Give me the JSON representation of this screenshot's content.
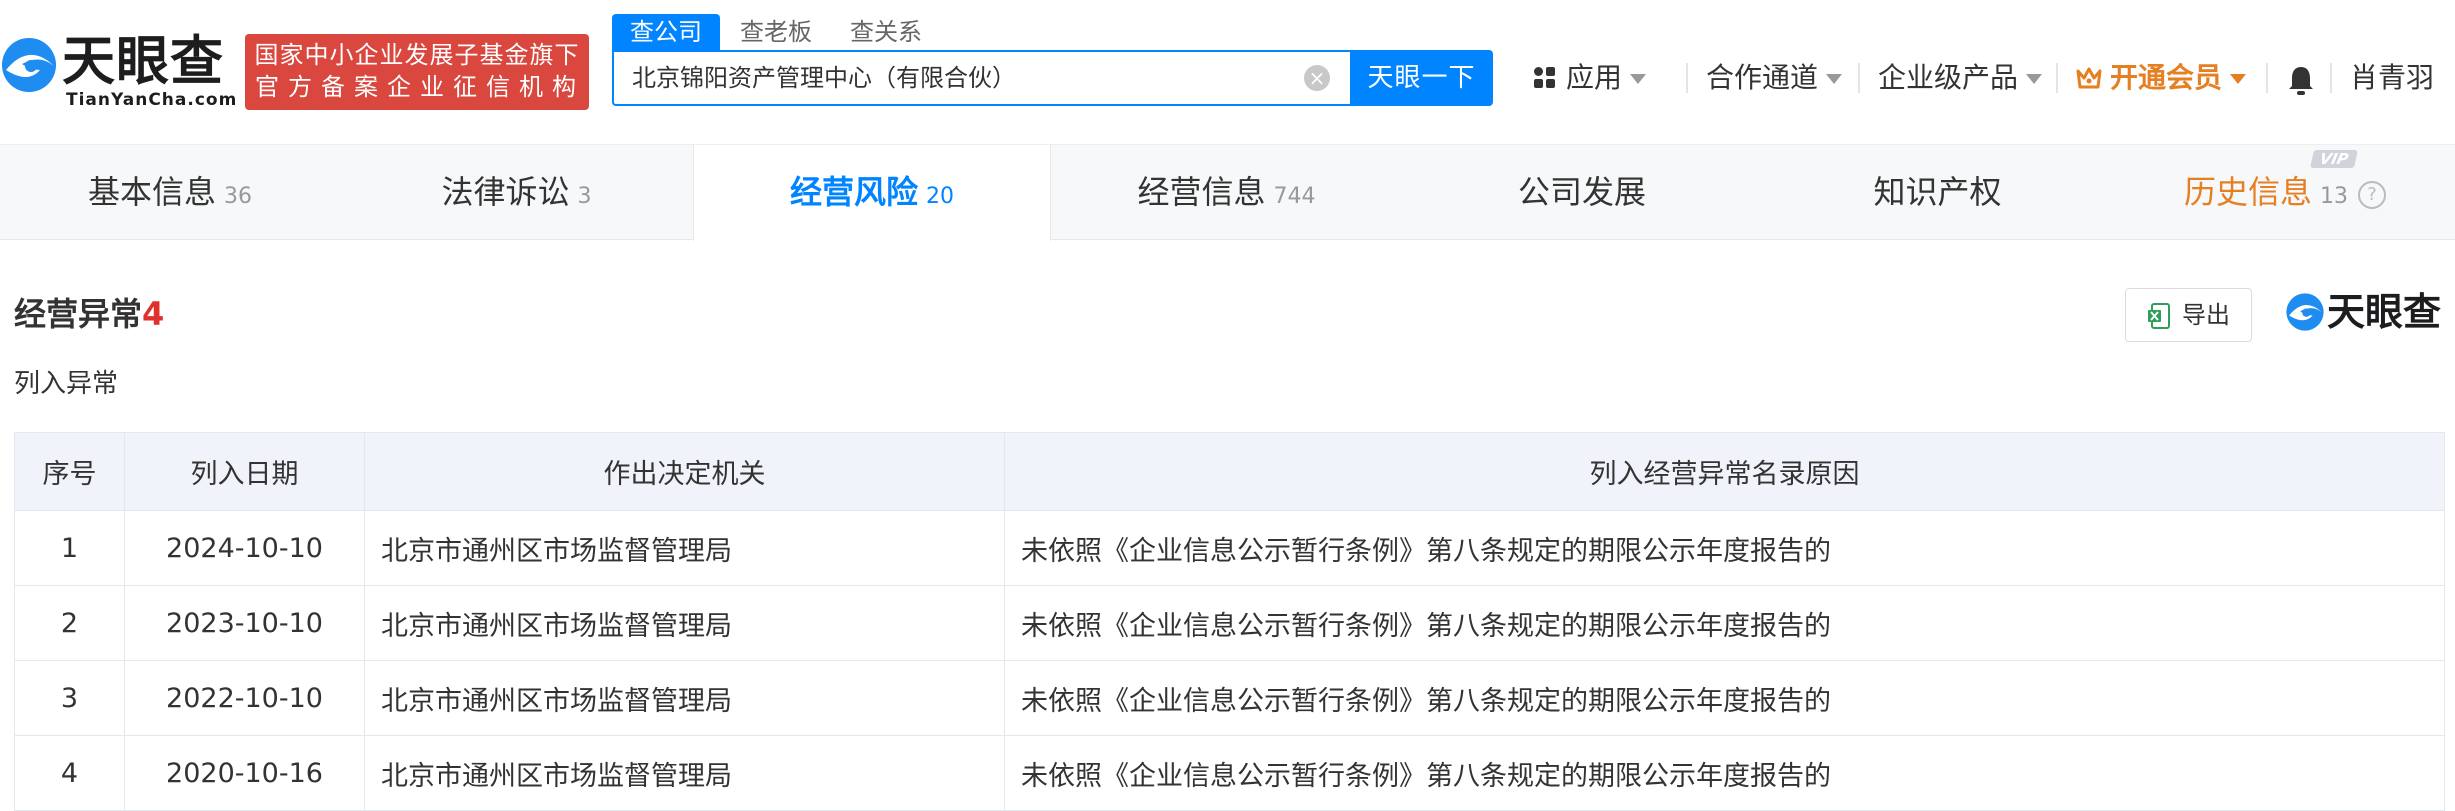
{
  "brand": {
    "name_cn": "天眼查",
    "name_en": "TianYanCha.com",
    "badge_line1": "国家中小企业发展子基金旗下",
    "badge_line2": "官方备案企业征信机构"
  },
  "search": {
    "tabs": [
      "查公司",
      "查老板",
      "查关系"
    ],
    "active_tab": "查公司",
    "value": "北京锦阳资产管理中心（有限合伙）",
    "button_label": "天眼一下"
  },
  "nav": {
    "apps": "应用",
    "partner": "合作通道",
    "enterprise": "企业级产品",
    "vip": "开通会员",
    "user": "肖青羽"
  },
  "tabs": [
    {
      "label": "基本信息",
      "count": "36"
    },
    {
      "label": "法律诉讼",
      "count": "3"
    },
    {
      "label": "经营风险",
      "count": "20"
    },
    {
      "label": "经营信息",
      "count": "744"
    },
    {
      "label": "公司发展",
      "count": ""
    },
    {
      "label": "知识产权",
      "count": ""
    },
    {
      "label": "历史信息",
      "count": "13"
    }
  ],
  "vip_badge": "VIP",
  "section": {
    "title": "经营异常",
    "count": "4",
    "export_label": "导出",
    "subtitle": "列入异常"
  },
  "table": {
    "headers": [
      "序号",
      "列入日期",
      "作出决定机关",
      "列入经营异常名录原因"
    ],
    "rows": [
      {
        "no": "1",
        "date": "2024-10-10",
        "authority": "北京市通州区市场监督管理局",
        "reason": "未依照《企业信息公示暂行条例》第八条规定的期限公示年度报告的"
      },
      {
        "no": "2",
        "date": "2023-10-10",
        "authority": "北京市通州区市场监督管理局",
        "reason": "未依照《企业信息公示暂行条例》第八条规定的期限公示年度报告的"
      },
      {
        "no": "3",
        "date": "2022-10-10",
        "authority": "北京市通州区市场监督管理局",
        "reason": "未依照《企业信息公示暂行条例》第八条规定的期限公示年度报告的"
      },
      {
        "no": "4",
        "date": "2020-10-16",
        "authority": "北京市通州区市场监督管理局",
        "reason": "未依照《企业信息公示暂行条例》第八条规定的期限公示年度报告的"
      }
    ]
  },
  "colors": {
    "accent": "#0084ff",
    "badge_red": "#d9473f",
    "vip_orange": "#e67e22",
    "count_red": "#e0302d"
  },
  "icons": [
    "logo-eye-icon",
    "clear-icon",
    "apps-icon",
    "chevron-down-icon",
    "crown-icon",
    "bell-icon",
    "excel-icon",
    "help-icon"
  ]
}
